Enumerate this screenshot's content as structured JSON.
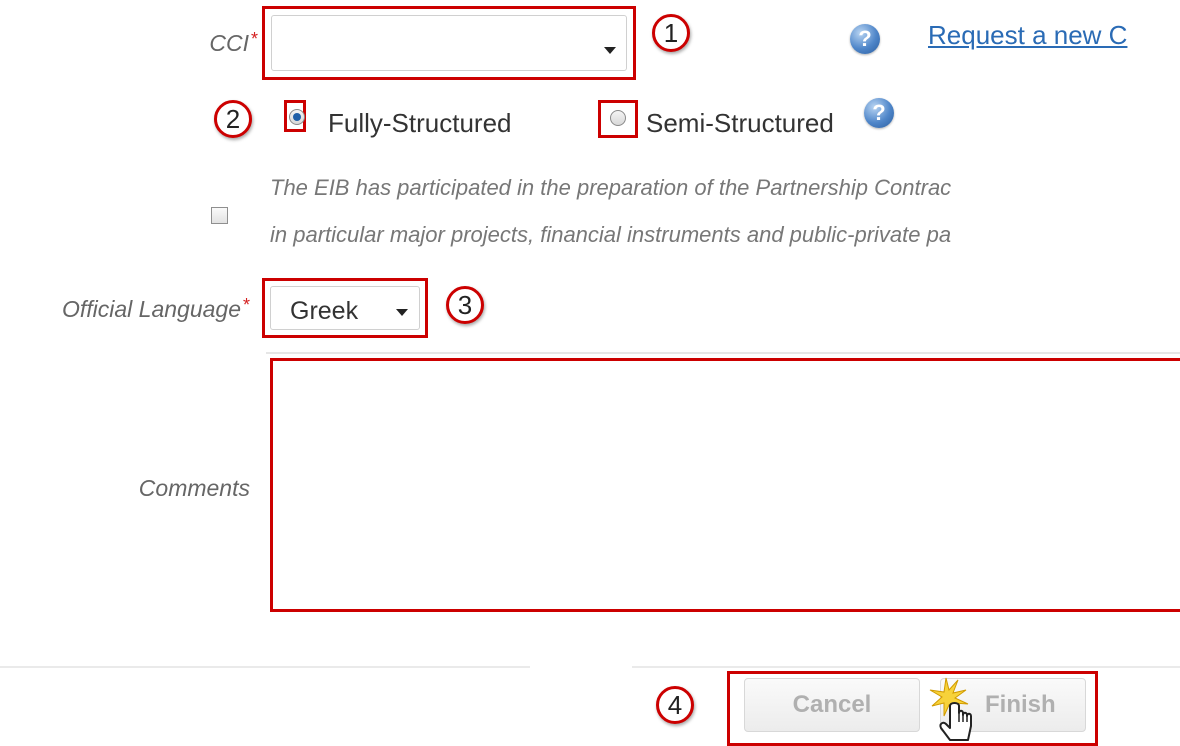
{
  "form": {
    "cci": {
      "label": "CCI",
      "required_mark": "*",
      "value": ""
    },
    "request_link": "Request a new C",
    "help_glyph": "?",
    "structure": {
      "fully_label": "Fully-Structured",
      "semi_label": "Semi-Structured",
      "selected": "Fully-Structured"
    },
    "eib_note": {
      "line1": "The EIB has participated in the preparation of the Partnership Contrac",
      "line2": "in particular major projects, financial instruments and public-private pa",
      "checked": false
    },
    "official_language": {
      "label": "Official Language",
      "required_mark": "*",
      "value": "Greek"
    },
    "comments": {
      "label": "Comments",
      "value": ""
    }
  },
  "buttons": {
    "cancel": "Cancel",
    "finish": "Finish"
  },
  "callouts": [
    "1",
    "2",
    "3",
    "4"
  ],
  "colors": {
    "highlight": "#cc0000",
    "required": "#d42020",
    "link": "#2a6bb5",
    "radio_selected": "#1f5fa8"
  }
}
